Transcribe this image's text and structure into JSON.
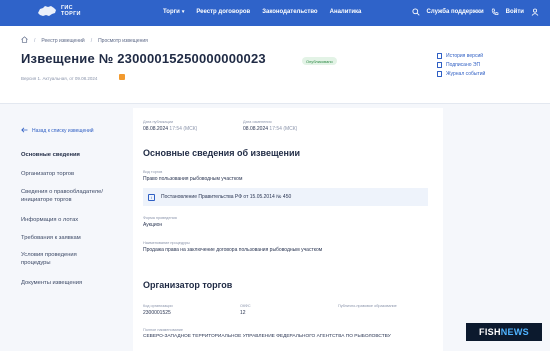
{
  "header": {
    "logo_line1": "ГИС",
    "logo_line2": "ТОРГИ",
    "nav": [
      "Торги",
      "Реестр договоров",
      "Законодательство",
      "Аналитика"
    ],
    "support": "Служба поддержки",
    "login": "Войти"
  },
  "breadcrumbs": [
    "Реестр извещений",
    "Просмотр извещения"
  ],
  "notice": {
    "title": "Извещение № 23000015250000000023",
    "status": "Опубликовано",
    "version": "Версия 1. Актуальная, от 09.08.2024"
  },
  "side_links": [
    "История версий",
    "Подписано ЭП",
    "Журнал событий"
  ],
  "back_link": "Назад к списку извещений",
  "menu": [
    "Основные сведения",
    "Организатор торгов",
    "Сведения о правообладателе/ инициаторе торгов",
    "Информация о лотах",
    "Требования к заявкам",
    "Условия проведения процедуры",
    "Документы извещения"
  ],
  "dates": {
    "published_label": "Дата публикации",
    "published_value": "08.08.2024",
    "published_time": "17:54 (МСК)",
    "changed_label": "Дата изменения",
    "changed_value": "08.08.2024",
    "changed_time": "17:54 (МСК)"
  },
  "basic": {
    "heading": "Основные сведения об извещении",
    "type_label": "Вид торгов",
    "type_value": "Право пользования рыбоводным участком",
    "decree": "Постановление Правительства РФ от 15.05.2014 № 450",
    "form_label": "Форма проведения",
    "form_value": "Аукцион",
    "proc_label": "Наименование процедуры",
    "proc_value": "Продажа права на заключение договора пользования рыбоводным участком"
  },
  "organizer": {
    "heading": "Организатор торгов",
    "code_label": "Код организации",
    "code_value": "2300001525",
    "okfs_label": "ОКФС",
    "okfs_value": "12",
    "opf_label": "Публично-правовое образование",
    "name_label": "Полное наименование",
    "name_value": "СЕВЕРО-ЗАПАДНОЕ ТЕРРИТОРИАЛЬНОЕ УПРАВЛЕНИЕ ФЕДЕРАЛЬНОГО АГЕНТСТВА ПО РЫБОЛОВСТВУ"
  },
  "watermark": {
    "part1": "FISH",
    "part2": "NEWS"
  },
  "colors": {
    "header": "#2f63c9",
    "accent": "#2f5fc4",
    "status_bg": "#e3f3e6",
    "status_fg": "#2d8a46"
  }
}
